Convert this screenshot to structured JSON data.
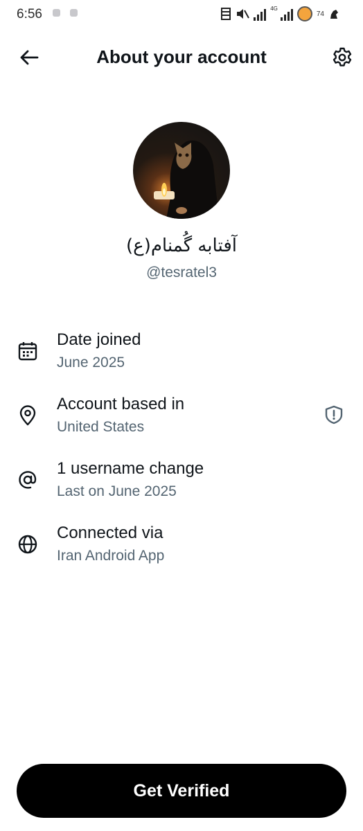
{
  "status_bar": {
    "time": "6:56",
    "network": "4G",
    "battery_level": "74",
    "battery_color": "#f3a43d"
  },
  "header": {
    "title": "About your account",
    "back_icon": "arrow-left-icon",
    "settings_icon": "gear-icon"
  },
  "profile": {
    "display_name": "آفتابه گُمنام(ع)",
    "handle": "@tesratel3"
  },
  "info": {
    "date_joined": {
      "icon": "calendar-icon",
      "title": "Date joined",
      "value": "June 2025"
    },
    "based_in": {
      "icon": "location-pin-icon",
      "title": "Account based in",
      "value": "United States",
      "action_icon": "shield-alert-icon"
    },
    "username_changes": {
      "icon": "at-sign-icon",
      "title": "1 username change",
      "value": "Last on June 2025"
    },
    "connected_via": {
      "icon": "globe-icon",
      "title": "Connected via",
      "value": "Iran Android App"
    }
  },
  "cta": {
    "label": "Get Verified"
  },
  "colors": {
    "text_primary": "#0f1419",
    "text_secondary": "#536471",
    "button_bg": "#000000"
  }
}
